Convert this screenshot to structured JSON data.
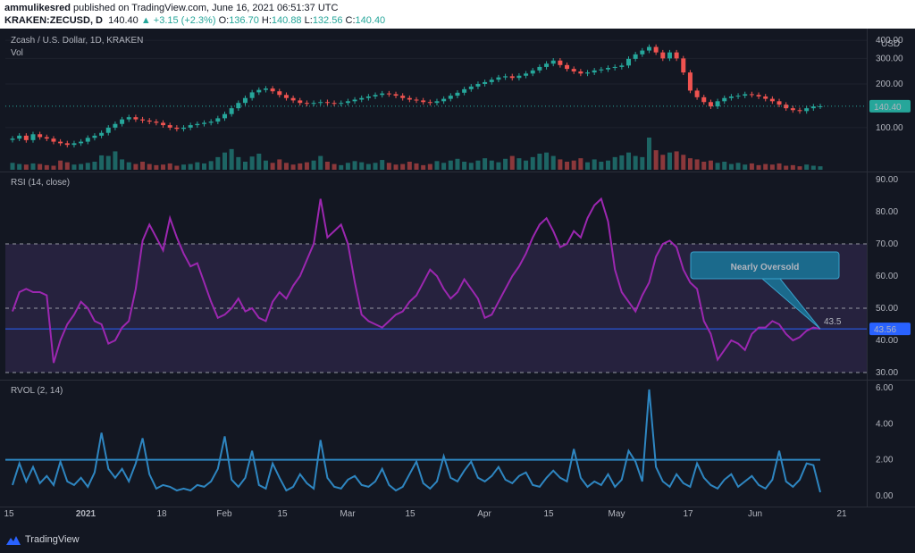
{
  "header": {
    "author": "ammulikesred",
    "published_text": "published on TradingView.com, June 16, 2021 06:51:37 UTC",
    "symbol": "KRAKEN:ZECUSD, D",
    "last": "140.40",
    "change": "▲ +3.15 (+2.3%)",
    "o_label": "O:",
    "o": "136.70",
    "h_label": "H:",
    "h": "140.88",
    "l_label": "L:",
    "l": "132.56",
    "c_label": "C:",
    "c": "140.40"
  },
  "footer": {
    "brand": "TradingView"
  },
  "colors": {
    "background": "#131722",
    "up": "#26a69a",
    "down": "#ef5350",
    "rsi_line": "#9c27b0",
    "rsi_band": "#7e57c2",
    "rvol_line": "#2e86c1",
    "rsi_mid_line": "#2962ff",
    "callout": "#1b6a8c"
  },
  "annotation": {
    "text": "Nearly Oversold",
    "value_text": "43.5"
  },
  "chart_data": [
    {
      "type": "candlestick",
      "title": "Zcash / U.S. Dollar, 1D, KRAKEN",
      "sublabel": "Vol",
      "y_scale": "log",
      "y_ticks": [
        "100.00",
        "200.00",
        "300.00",
        "400.00"
      ],
      "y_unit": "USD",
      "last_price_label": "140.40",
      "x_ticks": [
        "15",
        "2021",
        "18",
        "Feb",
        "15",
        "Mar",
        "15",
        "Apr",
        "15",
        "May",
        "17",
        "Jun",
        "21"
      ],
      "closes": [
        84,
        88,
        82,
        90,
        86,
        84,
        80,
        78,
        76,
        78,
        80,
        85,
        88,
        92,
        100,
        106,
        114,
        118,
        114,
        112,
        110,
        108,
        104,
        100,
        98,
        100,
        104,
        106,
        108,
        110,
        116,
        124,
        136,
        148,
        160,
        175,
        182,
        186,
        178,
        168,
        160,
        154,
        148,
        146,
        148,
        150,
        148,
        146,
        148,
        152,
        156,
        160,
        164,
        168,
        172,
        170,
        166,
        160,
        156,
        154,
        150,
        148,
        152,
        158,
        166,
        174,
        184,
        192,
        200,
        206,
        214,
        222,
        226,
        220,
        228,
        236,
        248,
        262,
        276,
        290,
        270,
        254,
        244,
        236,
        240,
        248,
        252,
        258,
        262,
        268,
        298,
        320,
        340,
        360,
        330,
        300,
        330,
        300,
        240,
        180,
        162,
        150,
        140,
        152,
        160,
        164,
        166,
        170,
        168,
        164,
        158,
        152,
        144,
        136,
        132,
        130,
        136,
        140,
        140.4
      ],
      "volumes": [
        1.2,
        1.0,
        0.9,
        1.1,
        1.0,
        0.8,
        0.7,
        1.6,
        1.3,
        0.9,
        1.0,
        1.2,
        1.4,
        2.5,
        2.4,
        3.2,
        1.8,
        1.3,
        1.0,
        1.4,
        1.0,
        0.8,
        0.9,
        1.1,
        0.7,
        0.9,
        1.0,
        1.3,
        1.1,
        1.5,
        2.2,
        3.0,
        3.6,
        2.2,
        1.4,
        2.3,
        2.8,
        1.6,
        1.2,
        1.8,
        1.2,
        0.9,
        1.1,
        1.3,
        1.6,
        2.4,
        1.4,
        1.0,
        0.8,
        1.2,
        1.5,
        1.3,
        1.0,
        1.2,
        1.7,
        1.2,
        0.9,
        1.0,
        1.4,
        1.1,
        0.8,
        1.0,
        1.5,
        1.2,
        1.6,
        1.9,
        1.4,
        1.2,
        1.6,
        2.0,
        1.6,
        1.3,
        1.9,
        2.4,
        2.0,
        1.6,
        2.2,
        2.8,
        3.0,
        2.4,
        1.8,
        1.4,
        1.6,
        2.0,
        1.3,
        1.8,
        1.4,
        1.6,
        2.2,
        2.5,
        3.0,
        2.4,
        2.2,
        5.6,
        3.4,
        2.6,
        3.0,
        3.2,
        2.6,
        2.0,
        1.8,
        1.4,
        1.6,
        1.2,
        1.4,
        1.0,
        1.2,
        0.9,
        1.1,
        0.8,
        1.0,
        0.9,
        1.1,
        0.7,
        0.8,
        0.6,
        0.9,
        0.7,
        0.6
      ]
    },
    {
      "type": "line",
      "title": "RSI (14, close)",
      "y_ticks": [
        "30.00",
        "40.00",
        "50.00",
        "60.00",
        "70.00",
        "80.00",
        "90.00"
      ],
      "ylim": [
        30,
        90
      ],
      "upper_band": 70,
      "lower_band": 30,
      "midline": 50,
      "signal_level": 43.56,
      "last_label": "43.56",
      "values": [
        49,
        55,
        56,
        55,
        55,
        54,
        33,
        40,
        45,
        48,
        52,
        50,
        46,
        45,
        39,
        40,
        44,
        46,
        56,
        71,
        76,
        72,
        68,
        78,
        72,
        67,
        63,
        64,
        58,
        52,
        47,
        48,
        50,
        53,
        49,
        50,
        47,
        46,
        52,
        55,
        53,
        57,
        60,
        65,
        70,
        84,
        72,
        74,
        76,
        70,
        58,
        48,
        46,
        45,
        44,
        46,
        48,
        49,
        52,
        54,
        58,
        62,
        60,
        56,
        53,
        55,
        59,
        56,
        53,
        47,
        48,
        52,
        56,
        60,
        63,
        67,
        72,
        76,
        78,
        74,
        69,
        70,
        74,
        72,
        78,
        82,
        84,
        77,
        62,
        55,
        52,
        49,
        54,
        58,
        66,
        70,
        71,
        69,
        62,
        58,
        56,
        46,
        42,
        34,
        37,
        40,
        39,
        37,
        42,
        44,
        44,
        46,
        45,
        42,
        40,
        41,
        43,
        44,
        43.56
      ]
    },
    {
      "type": "line",
      "title": "RVOL (2, 14)",
      "y_ticks": [
        "0.00",
        "2.00",
        "4.00",
        "6.00"
      ],
      "ylim": [
        0,
        6
      ],
      "threshold": 2,
      "values": [
        0.6,
        1.8,
        0.8,
        1.6,
        0.7,
        1.1,
        0.6,
        1.9,
        0.8,
        0.6,
        1.0,
        0.5,
        1.3,
        3.5,
        1.5,
        1.0,
        1.5,
        0.8,
        1.8,
        3.2,
        1.2,
        0.4,
        0.6,
        0.5,
        0.3,
        0.4,
        0.3,
        0.6,
        0.5,
        0.8,
        1.5,
        3.3,
        0.9,
        0.5,
        1.0,
        2.5,
        0.6,
        0.4,
        1.8,
        1.0,
        0.3,
        0.5,
        1.2,
        0.7,
        0.4,
        3.1,
        1.0,
        0.5,
        0.4,
        0.9,
        1.1,
        0.6,
        0.5,
        0.8,
        1.5,
        0.6,
        0.3,
        0.5,
        1.2,
        1.9,
        0.7,
        0.4,
        0.8,
        2.2,
        1.0,
        0.8,
        1.4,
        1.9,
        1.0,
        0.8,
        1.1,
        1.6,
        0.9,
        0.7,
        1.1,
        1.3,
        0.6,
        0.5,
        1.0,
        1.4,
        1.0,
        0.8,
        2.6,
        1.0,
        0.5,
        0.8,
        0.6,
        1.2,
        0.5,
        0.9,
        2.5,
        1.9,
        0.8,
        5.9,
        1.6,
        0.8,
        0.5,
        1.2,
        0.7,
        0.5,
        1.8,
        1.0,
        0.6,
        0.4,
        0.9,
        1.2,
        0.5,
        0.8,
        1.1,
        0.6,
        0.4,
        0.9,
        2.5,
        0.8,
        0.5,
        0.9,
        1.8,
        1.7,
        0.2
      ]
    }
  ]
}
